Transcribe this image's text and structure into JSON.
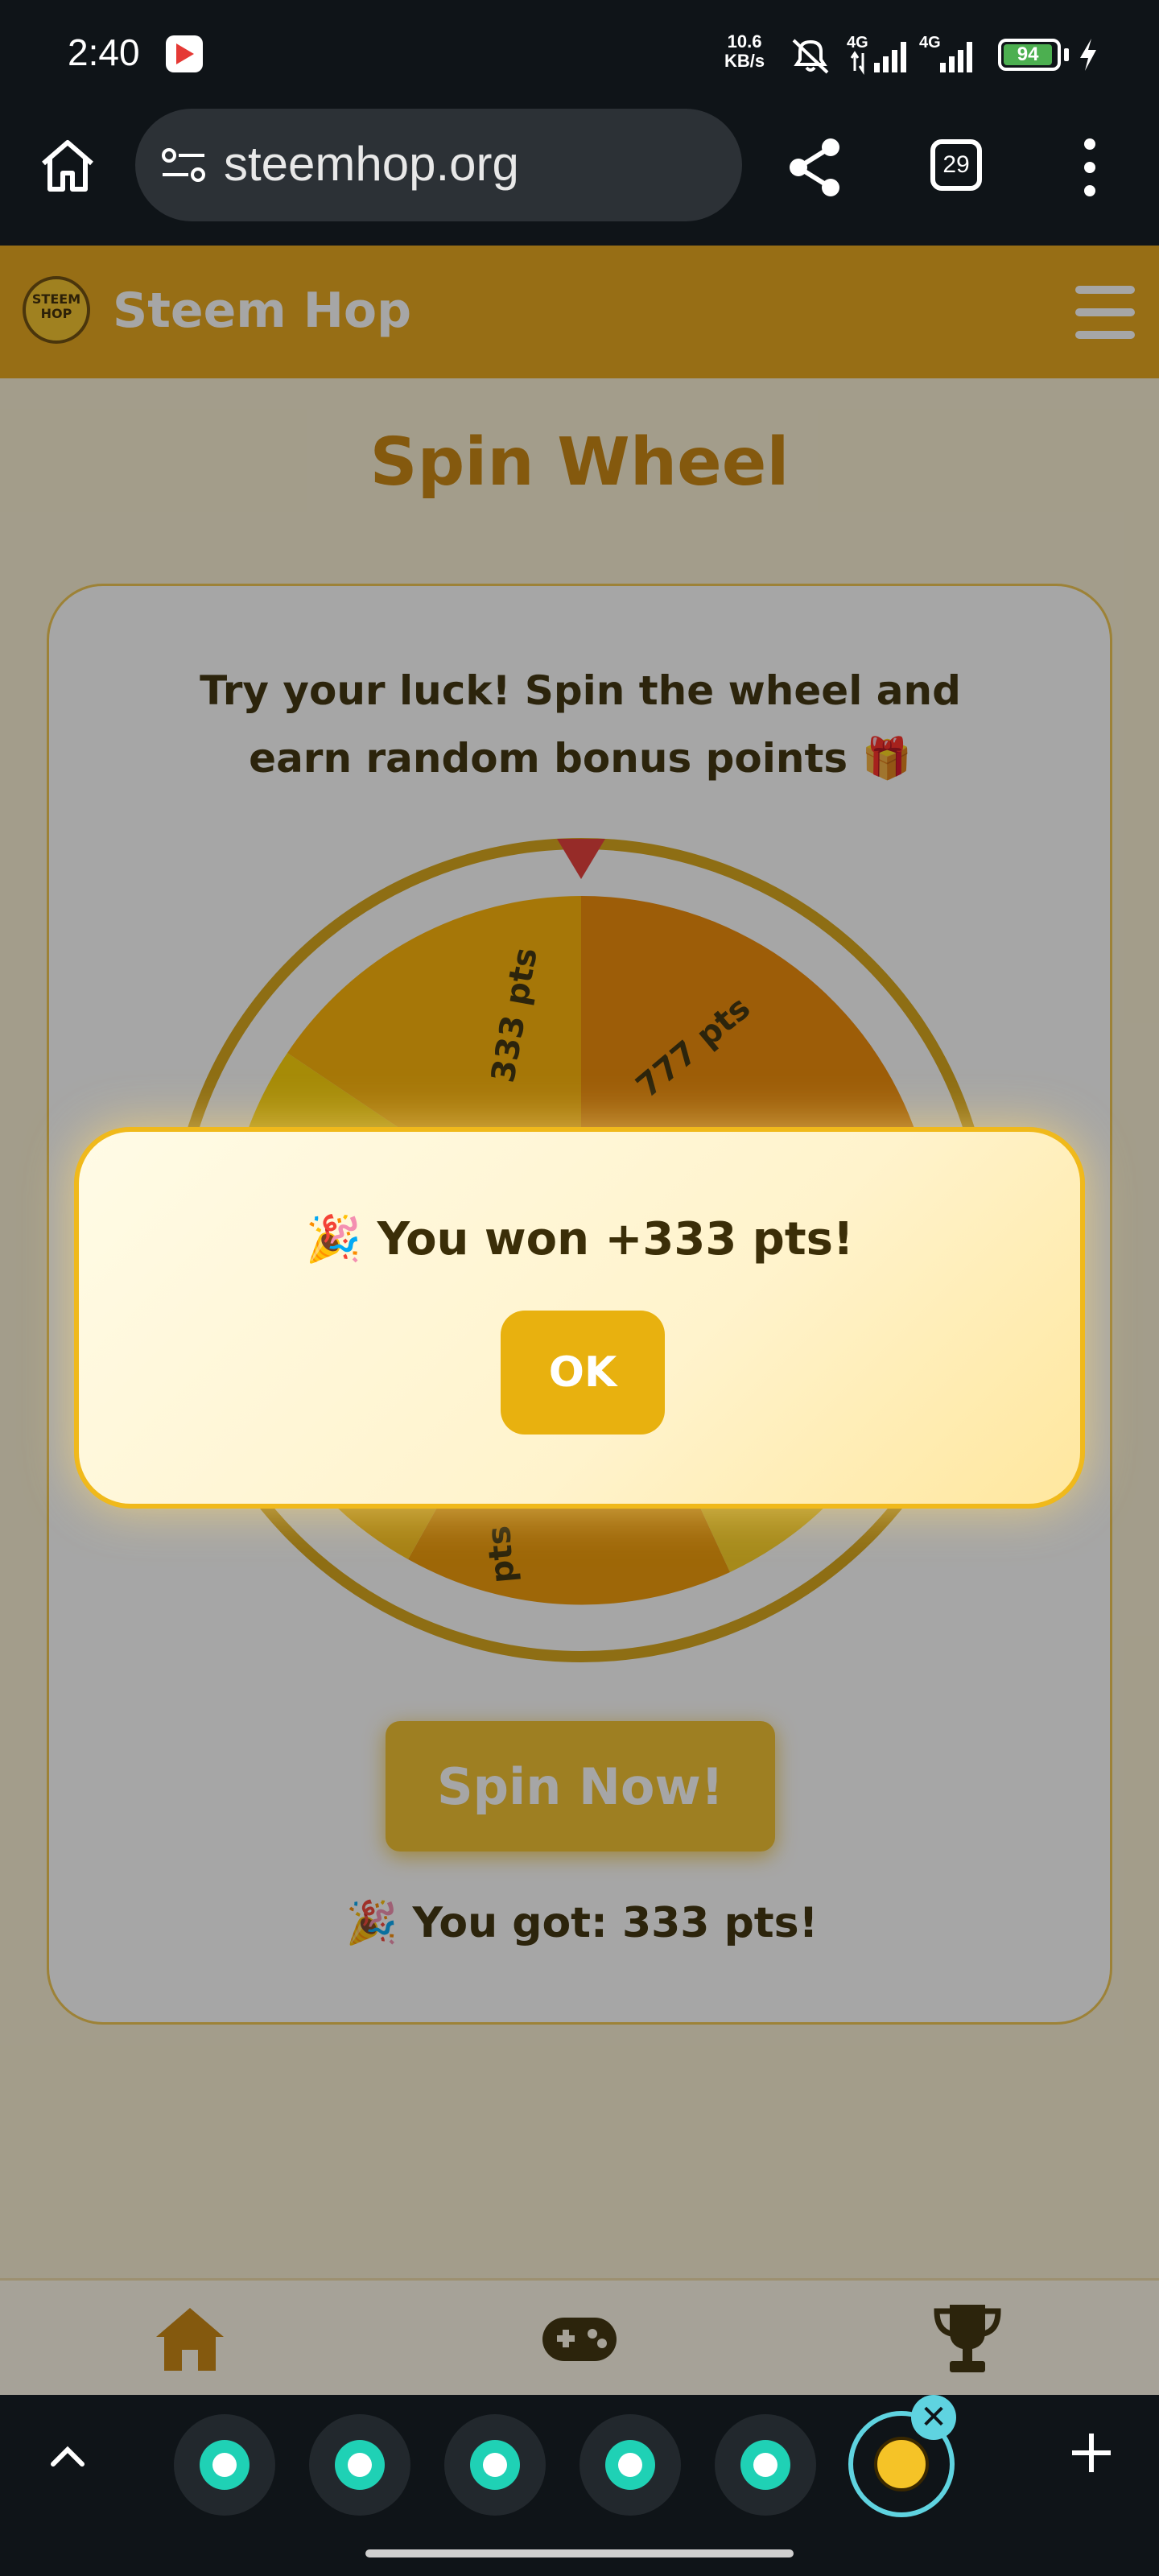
{
  "status_bar": {
    "time": "2:40",
    "speed_value": "10.6",
    "speed_unit": "KB/s",
    "network_1": "4G",
    "network_2": "4G",
    "battery": "94"
  },
  "browser": {
    "url": "steemhop.org",
    "tab_count": "29"
  },
  "site": {
    "logo_text": "STEEM HOP",
    "name": "Steem Hop"
  },
  "page": {
    "title": "Spin Wheel",
    "description": "Try your luck! Spin the wheel and earn random bonus points 🎁",
    "wheel_labels": [
      "333 pts",
      "777 pts",
      "pts"
    ],
    "spin_button": "Spin Now!",
    "result": "🎉 You got: 333 pts!"
  },
  "modal": {
    "message": "🎉 You won +333 pts!",
    "ok_button": "OK"
  },
  "bottom_nav": {
    "items": [
      "home-icon",
      "gamepad-icon",
      "trophy-icon"
    ]
  },
  "colors": {
    "brand": "#e7a515",
    "title": "#c8830b",
    "button": "#f2c02b",
    "wheel_rim": "#d9a514",
    "accent": "#5fd3e0"
  }
}
